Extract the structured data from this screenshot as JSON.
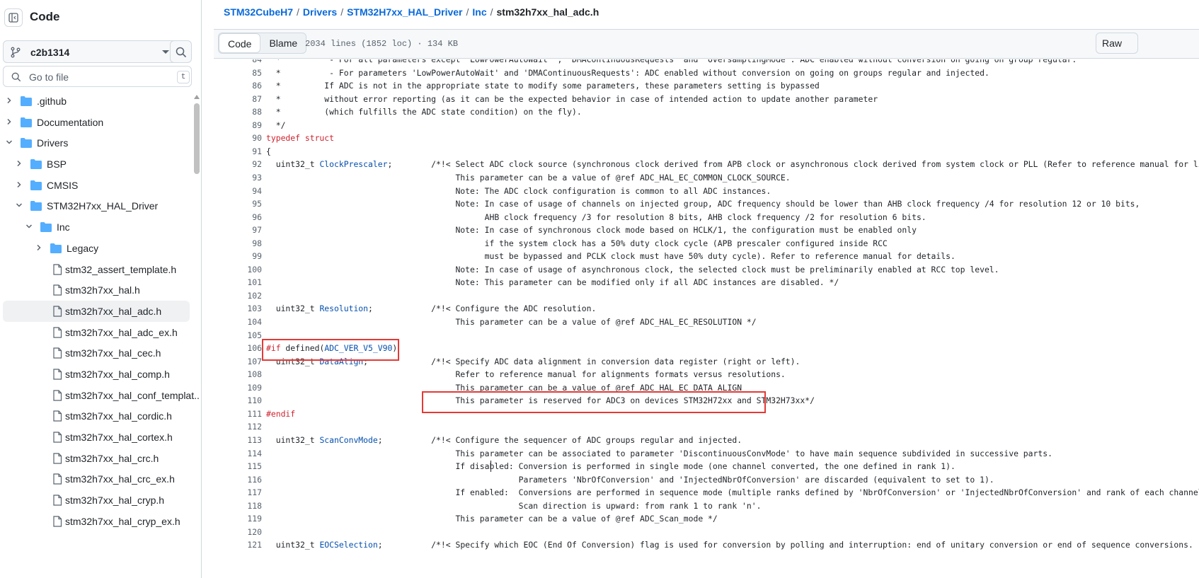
{
  "sidebar": {
    "title": "Code",
    "branch": "c2b1314",
    "goto_placeholder": "Go to file",
    "goto_shortcut": "t",
    "tree": [
      {
        "label": ".github",
        "type": "folder",
        "depth": 0,
        "expanded": false
      },
      {
        "label": "Documentation",
        "type": "folder",
        "depth": 0,
        "expanded": false
      },
      {
        "label": "Drivers",
        "type": "folder",
        "depth": 0,
        "expanded": true
      },
      {
        "label": "BSP",
        "type": "folder",
        "depth": 1,
        "expanded": false
      },
      {
        "label": "CMSIS",
        "type": "folder",
        "depth": 1,
        "expanded": false
      },
      {
        "label": "STM32H7xx_HAL_Driver",
        "type": "folder",
        "depth": 1,
        "expanded": true
      },
      {
        "label": "Inc",
        "type": "folder",
        "depth": 2,
        "expanded": true
      },
      {
        "label": "Legacy",
        "type": "folder",
        "depth": 3,
        "expanded": false
      },
      {
        "label": "stm32_assert_template.h",
        "type": "file",
        "depth": 3
      },
      {
        "label": "stm32h7xx_hal.h",
        "type": "file",
        "depth": 3
      },
      {
        "label": "stm32h7xx_hal_adc.h",
        "type": "file",
        "depth": 3,
        "selected": true
      },
      {
        "label": "stm32h7xx_hal_adc_ex.h",
        "type": "file",
        "depth": 3
      },
      {
        "label": "stm32h7xx_hal_cec.h",
        "type": "file",
        "depth": 3
      },
      {
        "label": "stm32h7xx_hal_comp.h",
        "type": "file",
        "depth": 3
      },
      {
        "label": "stm32h7xx_hal_conf_templat...",
        "type": "file",
        "depth": 3
      },
      {
        "label": "stm32h7xx_hal_cordic.h",
        "type": "file",
        "depth": 3
      },
      {
        "label": "stm32h7xx_hal_cortex.h",
        "type": "file",
        "depth": 3
      },
      {
        "label": "stm32h7xx_hal_crc.h",
        "type": "file",
        "depth": 3
      },
      {
        "label": "stm32h7xx_hal_crc_ex.h",
        "type": "file",
        "depth": 3
      },
      {
        "label": "stm32h7xx_hal_cryp.h",
        "type": "file",
        "depth": 3
      },
      {
        "label": "stm32h7xx_hal_cryp_ex.h",
        "type": "file",
        "depth": 3
      }
    ]
  },
  "breadcrumb": {
    "items": [
      "STM32CubeH7",
      "Drivers",
      "STM32H7xx_HAL_Driver",
      "Inc"
    ],
    "separator": "/",
    "current": "stm32h7xx_hal_adc.h"
  },
  "filebar": {
    "code_label": "Code",
    "blame_label": "Blame",
    "info": "2034 lines (1852 loc) · 134 KB",
    "raw_label": "Raw"
  },
  "colors": {
    "keyword": "#cf222e",
    "entity": "#0550ae",
    "link": "#0969da",
    "highlight_box": "#e53935"
  },
  "code_lines": [
    {
      "n": "84",
      "segs": [
        [
          "",
          "  *          - For all parameters except 'LowPowerAutoWait' , 'DMAContinuousRequests' and 'OversamplingMode': ADC enabled without conversion on going on group regular."
        ]
      ]
    },
    {
      "n": "85",
      "segs": [
        [
          "",
          "  *          - For parameters 'LowPowerAutoWait' and 'DMAContinuousRequests': ADC enabled without conversion on going on groups regular and injected."
        ]
      ]
    },
    {
      "n": "86",
      "segs": [
        [
          "",
          "  *         If ADC is not in the appropriate state to modify some parameters, these parameters setting is bypassed"
        ]
      ]
    },
    {
      "n": "87",
      "segs": [
        [
          "",
          "  *         without error reporting (as it can be the expected behavior in case of intended action to update another parameter"
        ]
      ]
    },
    {
      "n": "88",
      "segs": [
        [
          "",
          "  *         (which fulfills the ADC state condition) on the fly)."
        ]
      ]
    },
    {
      "n": "89",
      "segs": [
        [
          "",
          "  */"
        ]
      ]
    },
    {
      "n": "90",
      "segs": [
        [
          "kw",
          "typedef struct"
        ]
      ]
    },
    {
      "n": "91",
      "segs": [
        [
          "",
          "{"
        ]
      ]
    },
    {
      "n": "92",
      "segs": [
        [
          "",
          "  uint32_t "
        ],
        [
          "ent",
          "ClockPrescaler"
        ],
        [
          "",
          ";        /*!< Select ADC clock source (synchronous clock derived from APB clock or asynchronous clock derived from system clock or PLL (Refer to reference manual for list of all possible clock sources))."
        ]
      ]
    },
    {
      "n": "93",
      "segs": [
        [
          "",
          "                                       This parameter can be a value of @ref ADC_HAL_EC_COMMON_CLOCK_SOURCE."
        ]
      ]
    },
    {
      "n": "94",
      "segs": [
        [
          "",
          "                                       Note: The ADC clock configuration is common to all ADC instances."
        ]
      ]
    },
    {
      "n": "95",
      "segs": [
        [
          "",
          "                                       Note: In case of usage of channels on injected group, ADC frequency should be lower than AHB clock frequency /4 for resolution 12 or 10 bits,"
        ]
      ]
    },
    {
      "n": "96",
      "segs": [
        [
          "",
          "                                             AHB clock frequency /3 for resolution 8 bits, AHB clock frequency /2 for resolution 6 bits."
        ]
      ]
    },
    {
      "n": "97",
      "segs": [
        [
          "",
          "                                       Note: In case of synchronous clock mode based on HCLK/1, the configuration must be enabled only"
        ]
      ]
    },
    {
      "n": "98",
      "segs": [
        [
          "",
          "                                             if the system clock has a 50% duty clock cycle (APB prescaler configured inside RCC"
        ]
      ]
    },
    {
      "n": "99",
      "segs": [
        [
          "",
          "                                             must be bypassed and PCLK clock must have 50% duty cycle). Refer to reference manual for details."
        ]
      ]
    },
    {
      "n": "100",
      "segs": [
        [
          "",
          "                                       Note: In case of usage of asynchronous clock, the selected clock must be preliminarily enabled at RCC top level."
        ]
      ]
    },
    {
      "n": "101",
      "segs": [
        [
          "",
          "                                       Note: This parameter can be modified only if all ADC instances are disabled. */"
        ]
      ]
    },
    {
      "n": "102",
      "segs": [
        [
          "",
          ""
        ]
      ]
    },
    {
      "n": "103",
      "segs": [
        [
          "",
          "  uint32_t "
        ],
        [
          "ent",
          "Resolution"
        ],
        [
          "",
          ";            /*!< Configure the ADC resolution."
        ]
      ]
    },
    {
      "n": "104",
      "segs": [
        [
          "",
          "                                       This parameter can be a value of @ref ADC_HAL_EC_RESOLUTION */"
        ]
      ]
    },
    {
      "n": "105",
      "segs": [
        [
          "",
          ""
        ]
      ]
    },
    {
      "n": "106",
      "segs": [
        [
          "kw",
          "#if"
        ],
        [
          "",
          " defined("
        ],
        [
          "ent",
          "ADC_VER_V5_V90"
        ],
        [
          "",
          ")"
        ]
      ]
    },
    {
      "n": "107",
      "segs": [
        [
          "",
          "  uint32_t "
        ],
        [
          "ent",
          "DataAlign"
        ],
        [
          "",
          ";             /*!< Specify ADC data alignment in conversion data register (right or left)."
        ]
      ]
    },
    {
      "n": "108",
      "segs": [
        [
          "",
          "                                       Refer to reference manual for alignments formats versus resolutions."
        ]
      ]
    },
    {
      "n": "109",
      "segs": [
        [
          "",
          "                                       This parameter can be a value of @ref ADC_HAL_EC_DATA_ALIGN"
        ]
      ]
    },
    {
      "n": "110",
      "segs": [
        [
          "",
          "                                       This parameter is reserved for ADC3 on devices STM32H72xx and STM32H73xx*/"
        ]
      ]
    },
    {
      "n": "111",
      "segs": [
        [
          "kw",
          "#endif"
        ]
      ]
    },
    {
      "n": "112",
      "segs": [
        [
          "",
          ""
        ]
      ]
    },
    {
      "n": "113",
      "segs": [
        [
          "",
          "  uint32_t "
        ],
        [
          "ent",
          "ScanConvMode"
        ],
        [
          "",
          ";          /*!< Configure the sequencer of ADC groups regular and injected."
        ]
      ]
    },
    {
      "n": "114",
      "segs": [
        [
          "",
          "                                       This parameter can be associated to parameter 'DiscontinuousConvMode' to have main sequence subdivided in successive parts."
        ]
      ]
    },
    {
      "n": "115",
      "segs": [
        [
          "",
          "                                       If disabled: Conversion is performed in single mode (one channel converted, the one defined in rank 1)."
        ]
      ]
    },
    {
      "n": "116",
      "segs": [
        [
          "",
          "                                                    Parameters 'NbrOfConversion' and 'InjectedNbrOfConversion' are discarded (equivalent to set to 1)."
        ]
      ]
    },
    {
      "n": "117",
      "segs": [
        [
          "",
          "                                       If enabled:  Conversions are performed in sequence mode (multiple ranks defined by 'NbrOfConversion' or 'InjectedNbrOfConversion' and rank of each channel in sequencer)."
        ]
      ]
    },
    {
      "n": "118",
      "segs": [
        [
          "",
          "                                                    Scan direction is upward: from rank 1 to rank 'n'."
        ]
      ]
    },
    {
      "n": "119",
      "segs": [
        [
          "",
          "                                       This parameter can be a value of @ref ADC_Scan_mode */"
        ]
      ]
    },
    {
      "n": "120",
      "segs": [
        [
          "",
          ""
        ]
      ]
    },
    {
      "n": "121",
      "segs": [
        [
          "",
          "  uint32_t "
        ],
        [
          "ent",
          "EOCSelection"
        ],
        [
          "",
          ";          /*!< Specify which EOC (End Of Conversion) flag is used for conversion by polling and interruption: end of unitary conversion or end of sequence conversions."
        ]
      ]
    }
  ]
}
